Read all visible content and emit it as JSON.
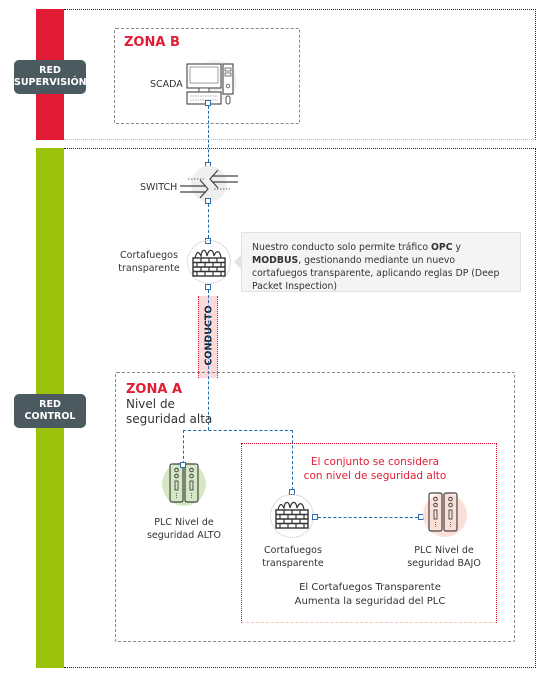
{
  "networks": {
    "supervision": {
      "label": "RED SUPERVISIÓN",
      "line1": "RED",
      "line2": "SUPERVISIÓN",
      "color": "#e21c34"
    },
    "control": {
      "label": "RED CONTROL",
      "line1": "RED",
      "line2": "CONTROL",
      "color": "#9ac10c"
    }
  },
  "zone_b": {
    "title": "ZONA B",
    "scada": {
      "label": "SCADA",
      "icon": "computer-icon"
    }
  },
  "switch": {
    "label": "SWITCH",
    "icon": "switch-arrows-icon"
  },
  "firewall_top": {
    "line1": "Cortafuegos",
    "line2": "transparente",
    "icon": "firewall-icon"
  },
  "note": {
    "part1": "Nuestro conducto solo permite tráfico ",
    "bold1": "OPC",
    "part2": " y ",
    "bold2": "MODBUS",
    "part3": ", gestionando mediante un nuevo cortafuegos transparente, aplicando reglas DP (Deep Packet Inspection)"
  },
  "conduit": {
    "label": "CONDUCTO"
  },
  "zone_a": {
    "title": "ZONA A",
    "subtitle1": "Nivel de",
    "subtitle2": "seguridad alta",
    "plc_high": {
      "line1": "PLC Nivel de",
      "line2": "seguridad ALTO",
      "icon": "plc-icon",
      "bg": "#d4e8c4"
    },
    "inner": {
      "title1": "El conjunto se considera",
      "title2": "con nivel de seguridad alto",
      "firewall": {
        "line1": "Cortafuegos",
        "line2": "transparente",
        "icon": "firewall-icon"
      },
      "plc_low": {
        "line1": "PLC Nivel de",
        "line2": "seguridad BAJO",
        "icon": "plc-icon",
        "bg": "#fbe0d8"
      },
      "caption1": "El Cortafuegos Transparente",
      "caption2": "Aumenta la seguridad del PLC"
    }
  },
  "colors": {
    "accent_red": "#e21c34",
    "link_blue": "#1e6aa8",
    "label_bg": "#4a5a60"
  }
}
